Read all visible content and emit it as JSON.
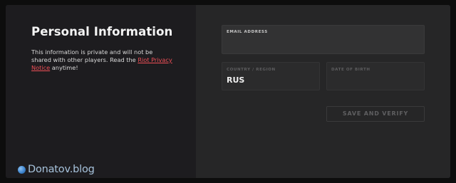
{
  "personal_info": {
    "title": "Personal Information",
    "description_before_link": "This information is private and will not be shared with other players. Read the ",
    "privacy_link_label": "Riot Privacy Notice",
    "description_after_link": " anytime!"
  },
  "form": {
    "email": {
      "label": "EMAIL ADDRESS",
      "value": ""
    },
    "country": {
      "label": "COUNTRY / REGION",
      "value": "RUS"
    },
    "dob": {
      "label": "DATE OF BIRTH",
      "value": ""
    },
    "submit_label": "SAVE AND VERIFY"
  },
  "watermark": {
    "text": "Donatov.blog"
  },
  "colors": {
    "link": "#ef4f57",
    "panel_left": "#1d1c1f",
    "panel_right": "#262627",
    "button_text_disabled": "#5f5f61"
  }
}
